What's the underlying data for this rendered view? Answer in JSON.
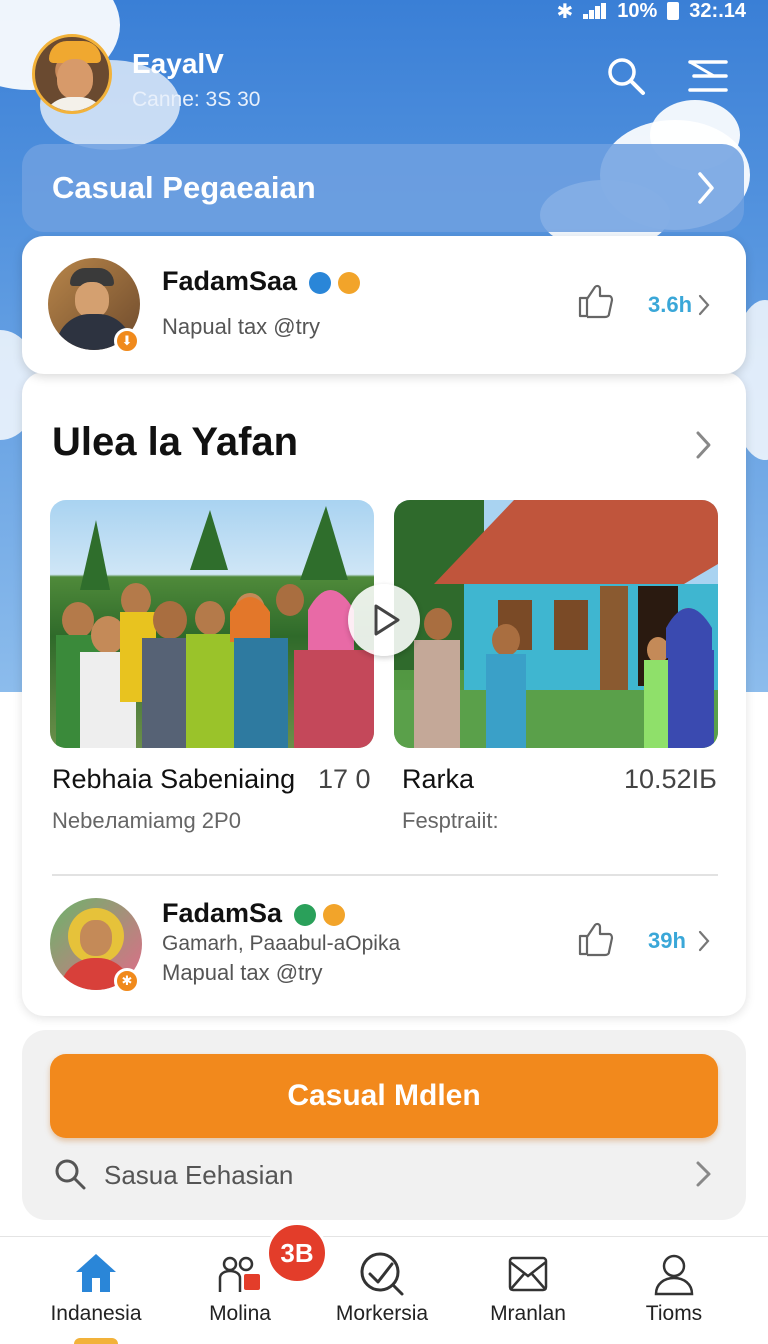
{
  "status_bar": {
    "battery": "10%",
    "time": "32:.14"
  },
  "header": {
    "user_name": "EayalV",
    "user_sub": "Canne: 3S 30"
  },
  "banner": {
    "title": "Casual Pegaeaian"
  },
  "top_post": {
    "name": "FadamSaa",
    "subtitle": "Napual  tax @try",
    "count": "3.6h"
  },
  "section": {
    "title": "Ulea la Yafan"
  },
  "videos": [
    {
      "title": "Rebhaia Sabeniaing",
      "meta": "17 0",
      "subtitle": "Nebeлamiamg 2P0"
    },
    {
      "title": "Rarka",
      "meta": "10.52IБ",
      "subtitle": "Fesptraiit:"
    }
  ],
  "bottom_post": {
    "name": "FadamSa",
    "line1": "Gamarh, Paaabul-aOpika",
    "line2": "Mapual  tax @try",
    "count": "39h"
  },
  "action": {
    "cta_label": "Casual Mdlen",
    "search_label": "Sasua Eehasian"
  },
  "nav": {
    "items": [
      {
        "label": "Indanesia"
      },
      {
        "label": "Molina"
      },
      {
        "label": "Morkersia"
      },
      {
        "label": "Mranlan"
      },
      {
        "label": "Tioms"
      }
    ],
    "badge": "3B"
  },
  "colors": {
    "accent": "#f2891c",
    "link": "#3aa7d8",
    "badge": "#e33d2a",
    "nav_active": "#2a86d8"
  }
}
